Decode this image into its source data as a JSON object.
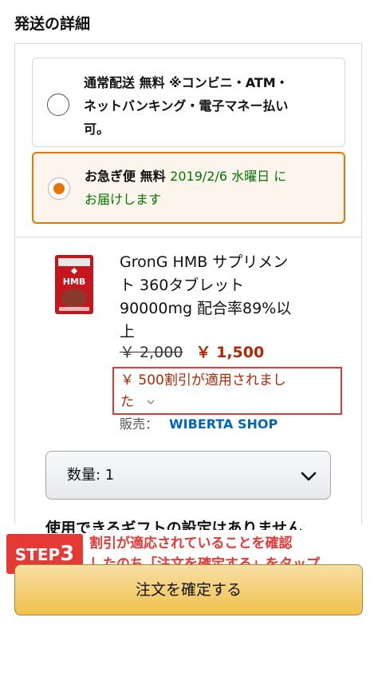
{
  "section_title": "発送の詳細",
  "shipping_options": [
    {
      "label_main": "通常配送 無料 ※コンビニ・ATM・",
      "label_line2": "ネットバンキング・電子マネー払い",
      "label_line3": "可。",
      "selected": false
    },
    {
      "label_bold": "お急ぎ便 無料",
      "label_green": "2019/2/6 水曜日 に",
      "label_line2": "お届けします",
      "selected": true
    }
  ],
  "product": {
    "title_lines": [
      "GronG HMB サプリメン",
      "ト 360タブレット",
      "90000mg 配合率89%以",
      "上"
    ],
    "price_old": "￥ 2,000",
    "price_new": "￥ 1,500",
    "discount_line1": "￥ 500割引が適用されまし",
    "discount_line2": "た",
    "seller_label": "販売：",
    "seller_name": "WIBERTA SHOP",
    "image_label": "HMB"
  },
  "quantity": {
    "label": "数量: 1"
  },
  "gift_text": "使用できるギフトの設定はありません",
  "step_badge": {
    "prefix": "STEP",
    "number": "3"
  },
  "annotation": {
    "line1": "割引が適応されていることを確認",
    "line2": "したのち「注文を確定する」をタップ"
  },
  "confirm_button": {
    "label": "注文を確定する"
  },
  "colors": {
    "accent_orange": "#e77600",
    "price_red": "#b12704",
    "delivery_green": "#007600",
    "link_blue": "#0066c0",
    "annotation_red": "#e53935",
    "button_yellow": "#f0c14b"
  }
}
